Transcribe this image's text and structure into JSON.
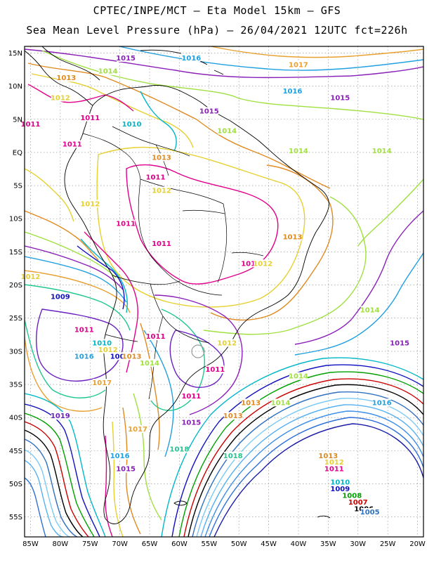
{
  "header": {
    "line1": "CPTEC/INPE/MCT –  Eta Model 15km – GFS",
    "line2": "Sea Mean Level Pressure (hPa) – 26/04/2021 12UTC fct=226h"
  },
  "axes": {
    "lat_labels": [
      "15N",
      "10N",
      "5N",
      "EQ",
      "5S",
      "10S",
      "15S",
      "20S",
      "25S",
      "30S",
      "35S",
      "40S",
      "45S",
      "50S",
      "55S"
    ],
    "lon_labels": [
      "85W",
      "80W",
      "75W",
      "70W",
      "65W",
      "60W",
      "55W",
      "50W",
      "45W",
      "40W",
      "35W",
      "30W",
      "25W",
      "20W"
    ]
  },
  "colors": {
    "c1000": "#1a1aa8",
    "c1001": "#2d6fd8",
    "c1002": "#3d8fe8",
    "c1003": "#55b0f0",
    "c1004": "#7ccaf5",
    "c1005": "#3070c0",
    "c1006": "#000000",
    "c1007": "#cc0000",
    "c1008": "#00a000",
    "c1009": "#1010c0",
    "c1010": "#00b8c8",
    "c1011": "#e0008a",
    "c1012": "#e6d030",
    "c1013": "#e08a20",
    "c1014": "#a0e040",
    "c1015": "#8a20b8",
    "c1016": "#20a0e0",
    "c1017": "#e8a030",
    "c1018": "#20c890",
    "c1019": "#6a20c0"
  },
  "contour_labels": [
    {
      "t": "1015",
      "c": "c1015",
      "lon": -69,
      "lat": 14
    },
    {
      "t": "1016",
      "c": "c1016",
      "lon": -58,
      "lat": 14
    },
    {
      "t": "1017",
      "c": "c1017",
      "lon": -40,
      "lat": 13
    },
    {
      "t": "1016",
      "c": "c1016",
      "lon": -41,
      "lat": 9
    },
    {
      "t": "1015",
      "c": "c1015",
      "lon": -33,
      "lat": 8
    },
    {
      "t": "1014",
      "c": "c1014",
      "lon": -72,
      "lat": 12
    },
    {
      "t": "1013",
      "c": "c1013",
      "lon": -79,
      "lat": 11
    },
    {
      "t": "1012",
      "c": "c1012",
      "lon": -80,
      "lat": 8
    },
    {
      "t": "1011",
      "c": "c1011",
      "lon": -85,
      "lat": 4
    },
    {
      "t": "1011",
      "c": "c1011",
      "lon": -75,
      "lat": 5
    },
    {
      "t": "1010",
      "c": "c1010",
      "lon": -68,
      "lat": 4
    },
    {
      "t": "1011",
      "c": "c1011",
      "lon": -78,
      "lat": 1
    },
    {
      "t": "1015",
      "c": "c1015",
      "lon": -55,
      "lat": 6
    },
    {
      "t": "1014",
      "c": "c1014",
      "lon": -52,
      "lat": 3
    },
    {
      "t": "1014",
      "c": "c1014",
      "lon": -40,
      "lat": 0
    },
    {
      "t": "1014",
      "c": "c1014",
      "lon": -26,
      "lat": 0
    },
    {
      "t": "1013",
      "c": "c1013",
      "lon": -63,
      "lat": -1
    },
    {
      "t": "1011",
      "c": "c1011",
      "lon": -64,
      "lat": -4
    },
    {
      "t": "1012",
      "c": "c1012",
      "lon": -63,
      "lat": -6
    },
    {
      "t": "1012",
      "c": "c1012",
      "lon": -75,
      "lat": -8
    },
    {
      "t": "1011",
      "c": "c1011",
      "lon": -69,
      "lat": -11
    },
    {
      "t": "1011",
      "c": "c1011",
      "lon": -63,
      "lat": -14
    },
    {
      "t": "1013",
      "c": "c1013",
      "lon": -41,
      "lat": -13
    },
    {
      "t": "1011",
      "c": "c1011",
      "lon": -48,
      "lat": -17
    },
    {
      "t": "1012",
      "c": "c1012",
      "lon": -46,
      "lat": -17
    },
    {
      "t": "1012",
      "c": "c1012",
      "lon": -85,
      "lat": -19
    },
    {
      "t": "1009",
      "c": "c1009",
      "lon": -80,
      "lat": -22
    },
    {
      "t": "1014",
      "c": "c1014",
      "lon": -28,
      "lat": -24
    },
    {
      "t": "1011",
      "c": "c1011",
      "lon": -76,
      "lat": -27
    },
    {
      "t": "1011",
      "c": "c1011",
      "lon": -64,
      "lat": -28
    },
    {
      "t": "1010",
      "c": "c1010",
      "lon": -73,
      "lat": -29
    },
    {
      "t": "1012",
      "c": "c1012",
      "lon": -72,
      "lat": -30
    },
    {
      "t": "1012",
      "c": "c1012",
      "lon": -52,
      "lat": -29
    },
    {
      "t": "1015",
      "c": "c1015",
      "lon": -23,
      "lat": -29
    },
    {
      "t": "1016",
      "c": "c1016",
      "lon": -76,
      "lat": -31
    },
    {
      "t": "1009",
      "c": "c1009",
      "lon": -70,
      "lat": -31
    },
    {
      "t": "1013",
      "c": "c1013",
      "lon": -68,
      "lat": -31
    },
    {
      "t": "1014",
      "c": "c1014",
      "lon": -65,
      "lat": -32
    },
    {
      "t": "1011",
      "c": "c1011",
      "lon": -54,
      "lat": -33
    },
    {
      "t": "1017",
      "c": "c1017",
      "lon": -73,
      "lat": -35
    },
    {
      "t": "1014",
      "c": "c1014",
      "lon": -40,
      "lat": -34
    },
    {
      "t": "1011",
      "c": "c1011",
      "lon": -58,
      "lat": -37
    },
    {
      "t": "1013",
      "c": "c1013",
      "lon": -48,
      "lat": -38
    },
    {
      "t": "1014",
      "c": "c1014",
      "lon": -43,
      "lat": -38
    },
    {
      "t": "1019",
      "c": "c1019",
      "lon": -80,
      "lat": -40
    },
    {
      "t": "1015",
      "c": "c1015",
      "lon": -58,
      "lat": -41
    },
    {
      "t": "1017",
      "c": "c1017",
      "lon": -67,
      "lat": -42
    },
    {
      "t": "1013",
      "c": "c1013",
      "lon": -51,
      "lat": -40
    },
    {
      "t": "1016",
      "c": "c1016",
      "lon": -26,
      "lat": -38
    },
    {
      "t": "1018",
      "c": "c1018",
      "lon": -60,
      "lat": -45
    },
    {
      "t": "1016",
      "c": "c1016",
      "lon": -70,
      "lat": -46
    },
    {
      "t": "1018",
      "c": "c1018",
      "lon": -51,
      "lat": -46
    },
    {
      "t": "1015",
      "c": "c1015",
      "lon": -69,
      "lat": -48
    },
    {
      "t": "1013",
      "c": "c1013",
      "lon": -35,
      "lat": -46
    },
    {
      "t": "1012",
      "c": "c1012",
      "lon": -34,
      "lat": -47
    },
    {
      "t": "1011",
      "c": "c1011",
      "lon": -34,
      "lat": -48
    },
    {
      "t": "1010",
      "c": "c1010",
      "lon": -33,
      "lat": -50
    },
    {
      "t": "1009",
      "c": "c1009",
      "lon": -33,
      "lat": -51
    },
    {
      "t": "1008",
      "c": "c1008",
      "lon": -31,
      "lat": -52
    },
    {
      "t": "1007",
      "c": "c1007",
      "lon": -30,
      "lat": -53
    },
    {
      "t": "1006",
      "c": "c1006",
      "lon": -29,
      "lat": -54
    },
    {
      "t": "1005",
      "c": "c1005",
      "lon": -28,
      "lat": -54.5
    }
  ]
}
